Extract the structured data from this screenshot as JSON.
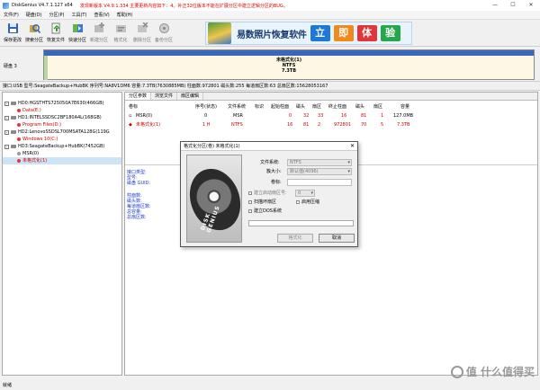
{
  "window": {
    "title": "DiskGenius V4.7.1.127 x64",
    "notice": "发现新版本 V4.9.1.334 主要更新内容如下：4。补正32位版本不能在扩展分区中建立逻辑分区的BUG。"
  },
  "menu": [
    "文件(F)",
    "硬盘(D)",
    "分区(P)",
    "工具(T)",
    "查看(V)",
    "帮助(H)"
  ],
  "toolbar": [
    {
      "label": "保存更改",
      "icon": "save-icon"
    },
    {
      "label": "搜索分区",
      "icon": "search-partition-icon"
    },
    {
      "label": "恢复文件",
      "icon": "recover-file-icon"
    },
    {
      "label": "快速分区",
      "icon": "quick-partition-icon"
    },
    {
      "label": "新建分区",
      "icon": "new-partition-icon"
    },
    {
      "label": "格式化",
      "icon": "format-icon"
    },
    {
      "label": "删除分区",
      "icon": "delete-partition-icon"
    },
    {
      "label": "备份分区",
      "icon": "backup-partition-icon"
    }
  ],
  "ad": {
    "text": "易数照片恢复软件",
    "boxes": [
      "立",
      "即",
      "体",
      "验"
    ]
  },
  "disk_bar": {
    "label": "硬盘 3",
    "part_name": "未格式化(1)",
    "part_fs": "NTFS",
    "part_size": "7.3TB"
  },
  "disk_info": "接口:USB  型号:SeagateBackup+HubBK  序列号:NA8V1DM6  容量:7.3TB(7630885MB)  柱面数:972801  磁头数:255  每道扇区数:63  总扇区数:15628053167",
  "tree": [
    {
      "label": "HD0:HGSTHTS725050A7E630(466GB)",
      "level": 0,
      "type": "disk"
    },
    {
      "label": "Data(E:)",
      "level": 1,
      "type": "part",
      "color": "red"
    },
    {
      "label": "HD1:INTELSSDSC2BF180A4L(168GB)",
      "level": 0,
      "type": "disk"
    },
    {
      "label": "Program Files(D:)",
      "level": 1,
      "type": "part",
      "color": "red"
    },
    {
      "label": "HD2:LenovoSSDSL700MSATA128G(119G",
      "level": 0,
      "type": "disk"
    },
    {
      "label": "Windows 10(C:)",
      "level": 1,
      "type": "part",
      "color": "red"
    },
    {
      "label": "HD3:SeagateBackup+HubBK(7452GB)",
      "level": 0,
      "type": "disk"
    },
    {
      "label": "MSR(0)",
      "level": 1,
      "type": "part",
      "color": "grey"
    },
    {
      "label": "未格式化(1)",
      "level": 1,
      "type": "part",
      "color": "red"
    }
  ],
  "tabs": [
    "分区参数",
    "浏览文件",
    "扇区编辑"
  ],
  "table": {
    "headers": [
      "卷标",
      "序号(状态)",
      "文件系统",
      "标识",
      "起始柱面",
      "磁头",
      "扇区",
      "终止柱面",
      "磁头",
      "扇区",
      "容量"
    ],
    "rows": [
      [
        "MSR(0)",
        "0",
        "MSR",
        "",
        "0",
        "32",
        "33",
        "16",
        "81",
        "1",
        "127.0MB"
      ],
      [
        "未格式化(1)",
        "1 H",
        "NTFS",
        "",
        "16",
        "81",
        "2",
        "972801",
        "70",
        "5",
        "7.3TB"
      ]
    ]
  },
  "info_labels_1": [
    "接口类型:",
    "型号:",
    "磁盘 GUID:"
  ],
  "info_labels_2": [
    "柱面数:",
    "磁头数:",
    "每道扇区数:",
    "总容量:",
    "总扇区数:"
  ],
  "status": "就绪",
  "watermark": "值 什么值得买",
  "dialog": {
    "title": "格式化分区(卷) 未格式化(1)",
    "fs_label": "文件系统:",
    "fs_value": "NTFS",
    "cluster_label": "簇大小:",
    "cluster_value": "默认值(4096)",
    "volume_label": "卷标:",
    "opt_boot": "建立启动扇区号:",
    "opt_boot_value": "0",
    "opt_badsector": "扫描坏扇区",
    "opt_compress": "启用压缩",
    "opt_dos": "建立DOS系统",
    "btn_format": "格式化",
    "btn_cancel": "取消",
    "image_text": "DISK GENIUS"
  }
}
